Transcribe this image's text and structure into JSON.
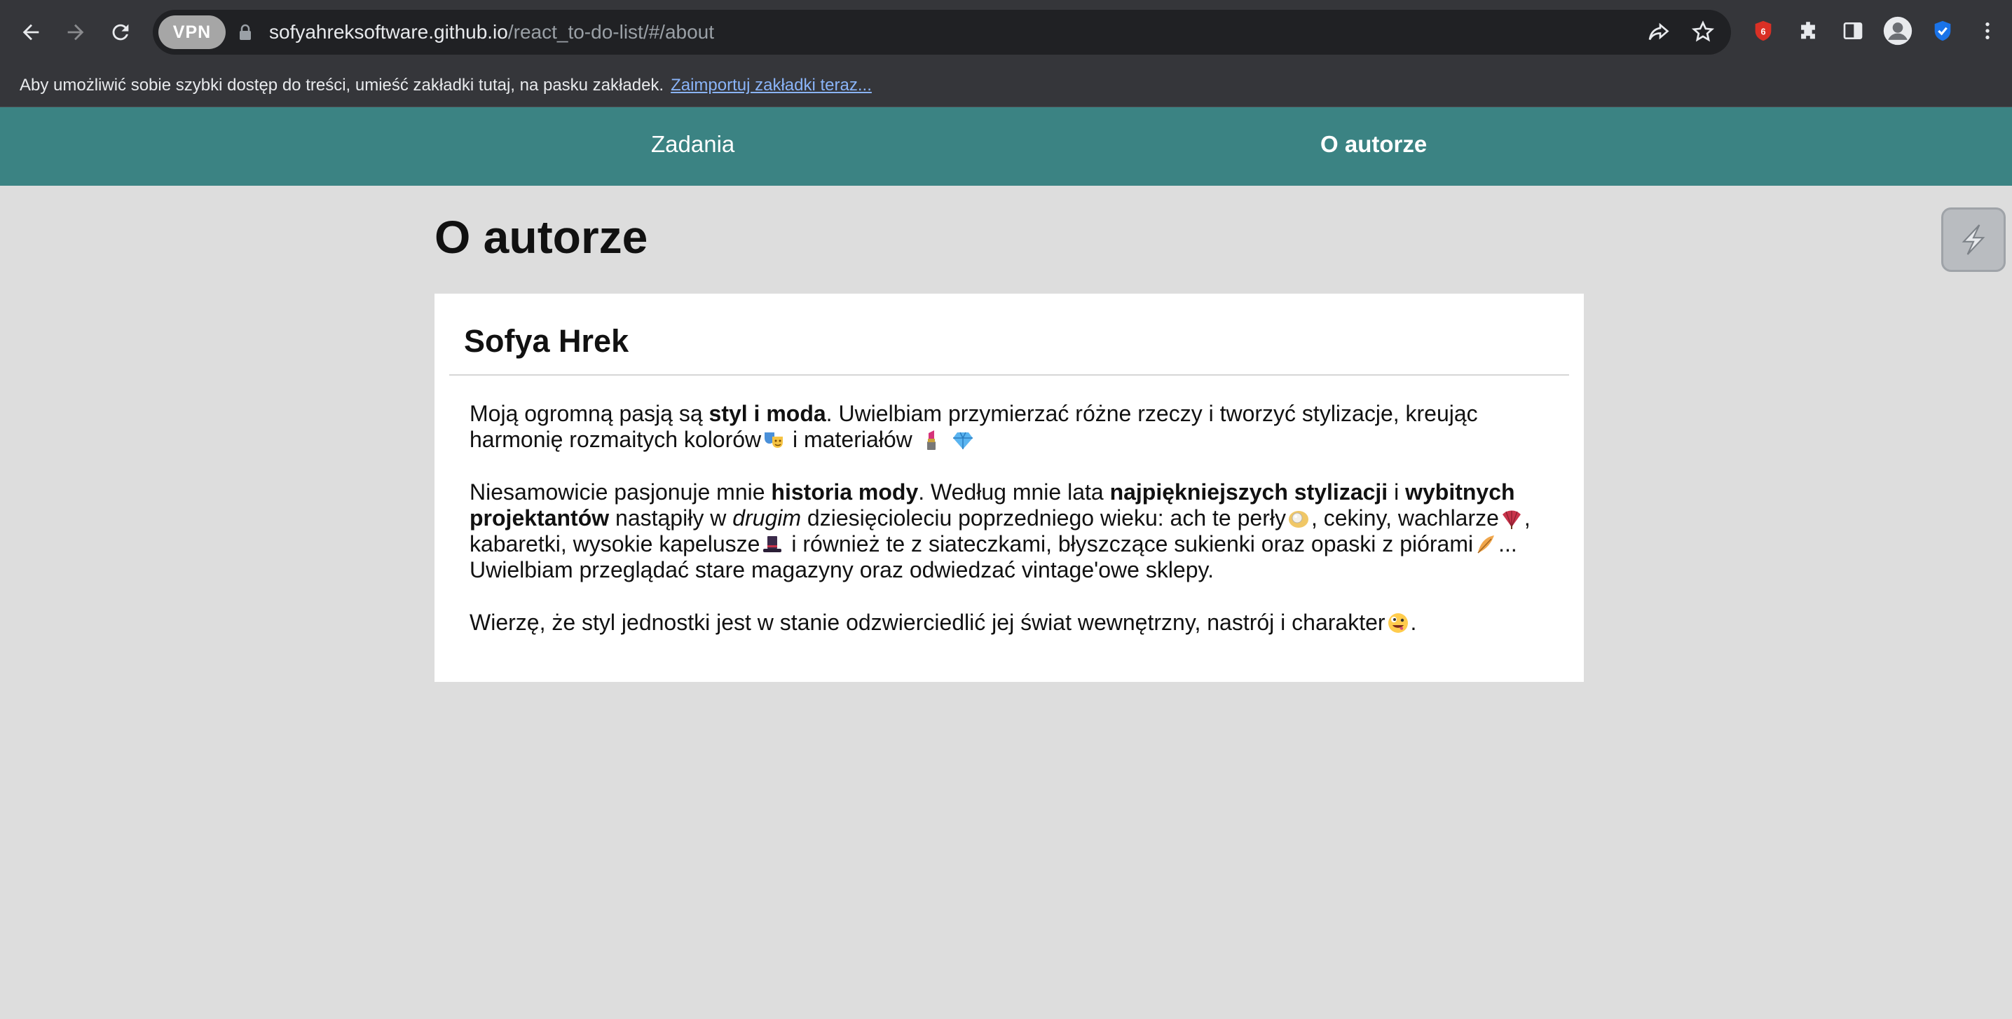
{
  "browser": {
    "vpn_label": "VPN",
    "url_host": "sofyahreksoftware.github.io",
    "url_path": "/react_to-do-list/#/about",
    "bookmarks_message": "Aby umożliwić sobie szybki dostęp do treści, umieść zakładki tutaj, na pasku zakładek.",
    "bookmarks_link": "Zaimportuj zakładki teraz..."
  },
  "nav": {
    "items": [
      {
        "label": "Zadania",
        "active": false
      },
      {
        "label": "O autorze",
        "active": true
      }
    ]
  },
  "page": {
    "title": "O autorze",
    "card_title": "Sofya Hrek",
    "p1": {
      "a": "Moją ogromną pasją są ",
      "b": "styl i moda",
      "c": ". Uwielbiam przymierzać różne rzeczy i tworzyć stylizacje, kreując harmonię rozmaitych kolorów",
      "d": " i materiałów"
    },
    "p2": {
      "a": "Niesamowicie pasjonuje mnie ",
      "b": "historia mody",
      "c": ". Według mnie lata ",
      "d": "najpiękniejszych stylizacji",
      "e": " i ",
      "f": "wybitnych projektantów",
      "g": " nastąpiły w ",
      "h": "drugim",
      "i": " dziesięcioleciu poprzedniego wieku: ach te perły",
      "j": ", cekiny, wachlarze",
      "k": ", kabaretki, wysokie kapelusze",
      "l": " i również te z siateczkami, błyszczące sukienki oraz opaski z piórami",
      "m": "... Uwielbiam przeglądać stare magazyny oraz odwiedzać vintage'owe sklepy."
    },
    "p3": {
      "a": "Wierzę, że styl jednostki jest w stanie odzwierciedlić jej świat wewnętrzny, nastrój i charakter",
      "b": "."
    }
  },
  "icons": {
    "p1_emojis": [
      "theater-masks-icon",
      "lipstick-icon",
      "gem-icon"
    ],
    "p2_emojis": [
      "pearl-icon",
      "fan-icon",
      "top-hat-icon",
      "feather-icon"
    ],
    "p3_emojis": [
      "zany-face-icon"
    ]
  },
  "colors": {
    "nav_bg": "#3b8383",
    "page_bg": "#dddddd",
    "chrome_bg": "#35363a",
    "link": "#8ab4f8"
  }
}
